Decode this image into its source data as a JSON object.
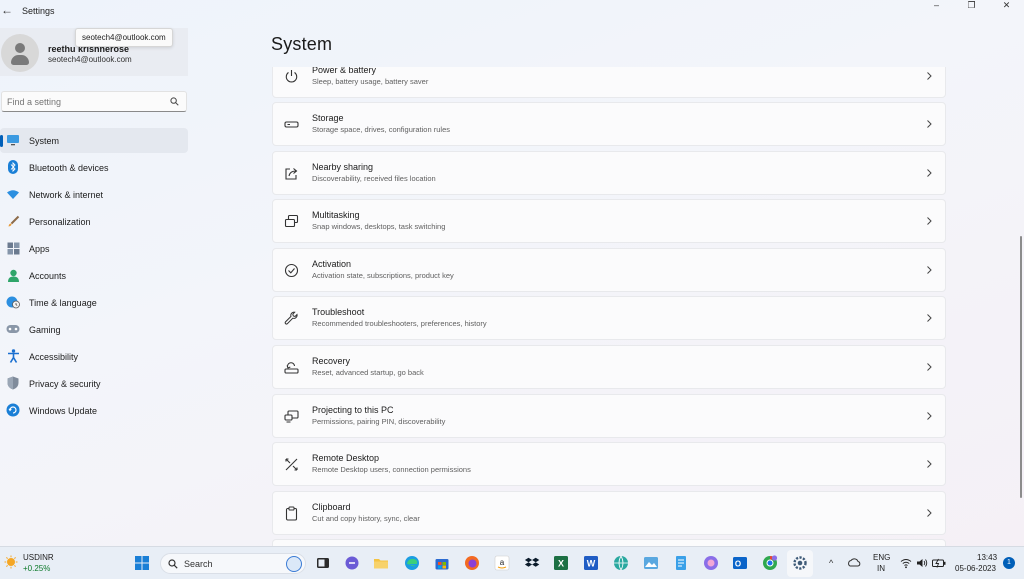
{
  "window": {
    "title": "Settings",
    "back_glyph": "←",
    "controls": [
      "–",
      "❐",
      "✕"
    ]
  },
  "profile": {
    "name": "reethu krishnerose",
    "email": "seotech4@outlook.com",
    "tooltip": "seotech4@outlook.com"
  },
  "search": {
    "placeholder": "Find a setting"
  },
  "nav": {
    "items": [
      {
        "label": "System",
        "icon": "monitor-icon",
        "selected": true
      },
      {
        "label": "Bluetooth & devices",
        "icon": "bluetooth-icon"
      },
      {
        "label": "Network & internet",
        "icon": "wifi-icon"
      },
      {
        "label": "Personalization",
        "icon": "brush-icon"
      },
      {
        "label": "Apps",
        "icon": "apps-icon"
      },
      {
        "label": "Accounts",
        "icon": "person-icon"
      },
      {
        "label": "Time & language",
        "icon": "globe-clock-icon"
      },
      {
        "label": "Gaming",
        "icon": "gamepad-icon"
      },
      {
        "label": "Accessibility",
        "icon": "accessibility-icon"
      },
      {
        "label": "Privacy & security",
        "icon": "shield-icon"
      },
      {
        "label": "Windows Update",
        "icon": "update-icon"
      }
    ]
  },
  "main": {
    "title": "System",
    "cards": [
      {
        "title": "Power & battery",
        "subtitle": "Sleep, battery usage, battery saver",
        "icon": "power-icon"
      },
      {
        "title": "Storage",
        "subtitle": "Storage space, drives, configuration rules",
        "icon": "storage-icon"
      },
      {
        "title": "Nearby sharing",
        "subtitle": "Discoverability, received files location",
        "icon": "share-icon"
      },
      {
        "title": "Multitasking",
        "subtitle": "Snap windows, desktops, task switching",
        "icon": "multitasking-icon"
      },
      {
        "title": "Activation",
        "subtitle": "Activation state, subscriptions, product key",
        "icon": "check-circle-icon"
      },
      {
        "title": "Troubleshoot",
        "subtitle": "Recommended troubleshooters, preferences, history",
        "icon": "wrench-icon"
      },
      {
        "title": "Recovery",
        "subtitle": "Reset, advanced startup, go back",
        "icon": "recovery-icon"
      },
      {
        "title": "Projecting to this PC",
        "subtitle": "Permissions, pairing PIN, discoverability",
        "icon": "projecting-icon"
      },
      {
        "title": "Remote Desktop",
        "subtitle": "Remote Desktop users, connection permissions",
        "icon": "remote-desktop-icon"
      },
      {
        "title": "Clipboard",
        "subtitle": "Cut and copy history, sync, clear",
        "icon": "clipboard-icon"
      }
    ]
  },
  "taskbar": {
    "ticker": {
      "name": "USDINR",
      "change": "+0.25%"
    },
    "search_label": "Search",
    "language": {
      "line1": "ENG",
      "line2": "IN"
    },
    "clock": {
      "time": "13:43",
      "date": "05-06-2023"
    },
    "notification_count": "1",
    "tray_chevron": "^",
    "colors": {
      "accent": "#005fb8",
      "ticker_up": "#0d7a2b"
    }
  }
}
